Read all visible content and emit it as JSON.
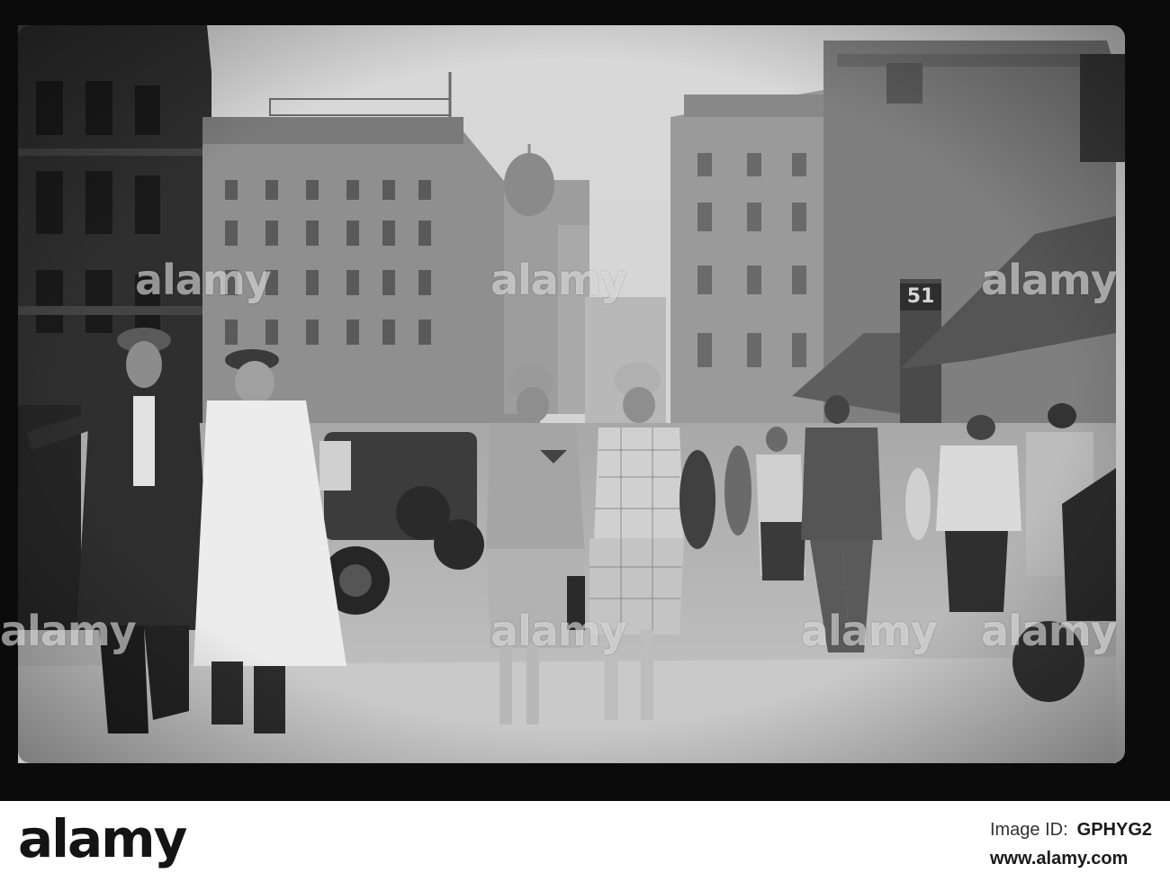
{
  "photo": {
    "description_alt": "Vintage black and white street scene",
    "door_number": "51"
  },
  "watermark": {
    "text": "alamy"
  },
  "footer": {
    "logo": "alamy",
    "image_id_label": "Image ID:",
    "image_id": "GPHYG2",
    "site": "www.alamy.com"
  }
}
